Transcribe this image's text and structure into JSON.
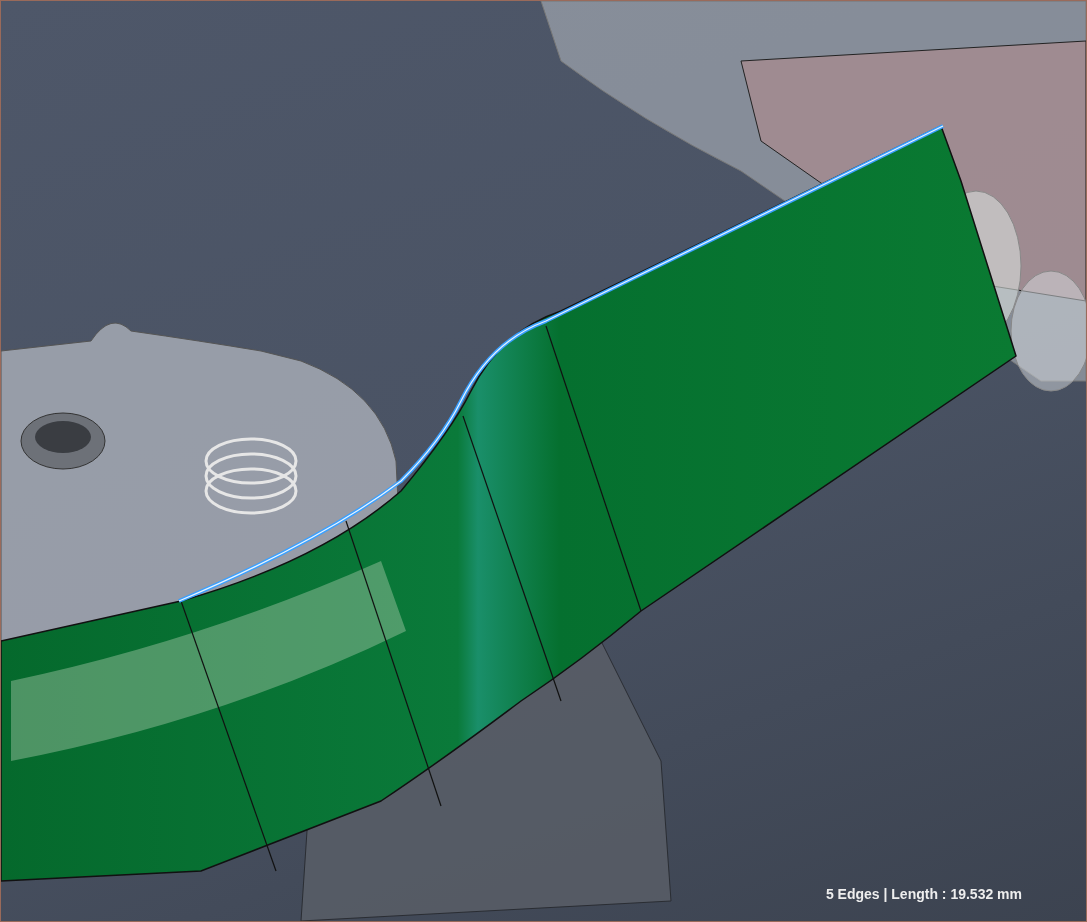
{
  "viewport": {
    "status_text": "5 Edges | Length : 19.532 mm"
  }
}
